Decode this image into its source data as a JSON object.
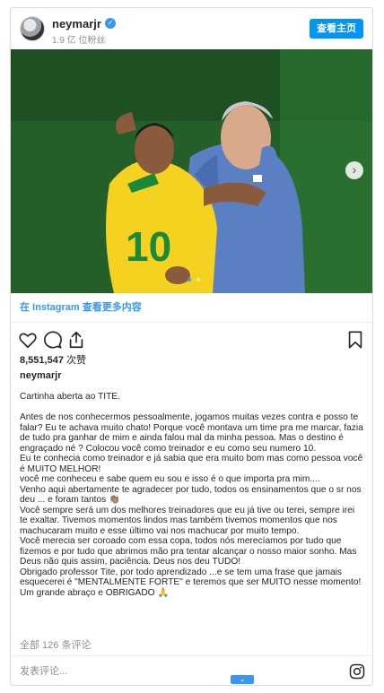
{
  "header": {
    "username": "neymarjr",
    "followers": "1.9 亿 位粉丝",
    "follow_label": "查看主页"
  },
  "carousel": {
    "next_icon": "chevron-right-icon",
    "jersey_number": "10",
    "slide_count": 2,
    "active_slide": 1
  },
  "instagram_link": {
    "prefix": "在 Instagram",
    "more": "查看更多内容"
  },
  "actions": {
    "icons": [
      "heart-icon",
      "comment-icon",
      "share-icon",
      "bookmark-icon"
    ]
  },
  "likes": {
    "count": "8,551,547",
    "label": "次赞"
  },
  "author": "neymarjr",
  "caption": [
    "Cartinha aberta ao TITE.",
    "",
    "Antes de nos conhecermos pessoalmente, jogamos muitas vezes contra e posso te falar? Eu te achava muito chato! Porque você montava um time pra me marcar, fazia de tudo pra ganhar de mim e ainda falou mal da minha pessoa. Mas o destino é engraçado né ? Colocou você como treinador e eu como seu numero 10.",
    "Eu te conhecia como treinador e já sabia que era muito bom mas como pessoa você é MUITO MELHOR!",
    "você me conheceu e sabe quem eu sou e isso é o que importa pra mim....",
    "Venho aqui abertamente te agradecer por tudo, todos os ensinamentos que o sr nos deu ... e foram tantos 👏🏽",
    "Você sempre será um dos melhores treinadores que eu já tive ou terei, sempre irei te exaltar. Tivemos momentos lindos mas também tivemos momentos que nos machucaram muito e esse último vai nos machucar por muito tempo.",
    "Você merecia ser coroado com essa copa, todos nós merecíamos por tudo que fizemos e por tudo que abrimos mão pra tentar alcançar o nosso maior sonho. Mas Deus não quis assim, paciência. Deus nos deu TUDO!",
    "Obrigado professor Tite, por todo aprendizado ...e se tem uma frase que jamais esquecerei é \"MENTALMENTE FORTE\" e teremos que ser MUITO nesse momento!",
    "Um grande abraço e OBRIGADO 🙏"
  ],
  "comments": {
    "count_label": "全部 126 条评论",
    "placeholder": "发表评论..."
  },
  "colors": {
    "accent": "#0095f6",
    "link": "#00376b",
    "muted": "#8e8e8e",
    "jersey_yellow": "#f4d21f",
    "shirt_blue": "#5b7fc3"
  }
}
